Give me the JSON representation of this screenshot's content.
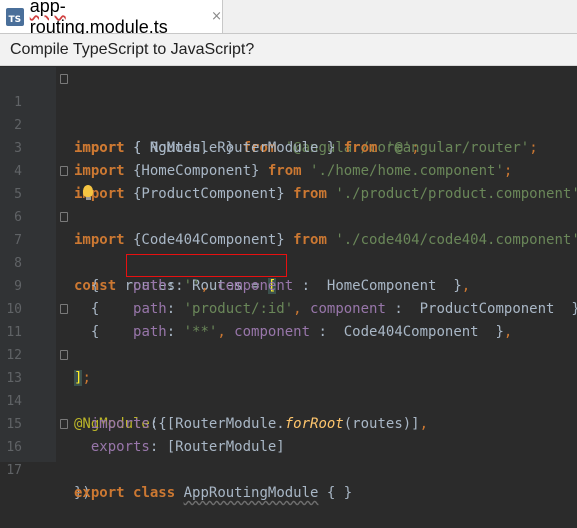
{
  "tab": {
    "icon_label": "TS",
    "title": "app-routing.module.ts",
    "close": "×"
  },
  "notice": {
    "text": "Compile TypeScript to JavaScript?"
  },
  "lines": [
    {
      "n": "1"
    },
    {
      "n": "2"
    },
    {
      "n": "3"
    },
    {
      "n": "4"
    },
    {
      "n": "5"
    },
    {
      "n": "6"
    },
    {
      "n": "7"
    },
    {
      "n": "8"
    },
    {
      "n": "9"
    },
    {
      "n": "10"
    },
    {
      "n": "11"
    },
    {
      "n": "12"
    },
    {
      "n": "13"
    },
    {
      "n": "14"
    },
    {
      "n": "15"
    },
    {
      "n": "16"
    },
    {
      "n": "17"
    }
  ],
  "code": {
    "l1": {
      "kw": "import",
      "mid": " { NgModule } ",
      "from": "from",
      "str": "'@angular/core'",
      "end": ";"
    },
    "l2": {
      "kw": "import",
      "mid": " { Routes, RouterModule } ",
      "from": "from",
      "str": "'@angular/router'",
      "end": ";"
    },
    "l3": {
      "kw": "import",
      "mid": " {HomeComponent} ",
      "from": "from",
      "str": "'./home/home.component'",
      "end": ";"
    },
    "l4": {
      "kw": "import",
      "mid": " {ProductComponent} ",
      "from": "from",
      "str": "'./product/product.component'",
      "end": ";"
    },
    "l5": {
      "kw": "import",
      "mid": " {Code404Component} ",
      "from": "from",
      "str": "'./code404/code404.component'",
      "end": ";"
    },
    "l7": {
      "kw": "const",
      "mid": " routes: Routes = ",
      "brk": "["
    },
    "l8": {
      "open": "{",
      "path": "path",
      "colon": ": ",
      "str": "''",
      "comma": ", ",
      "comp": "component",
      "sep": " :  ",
      "val": "HomeComponent",
      "close": "  }",
      "end": ","
    },
    "l9": {
      "open": "{",
      "path": "path",
      "colon": ": ",
      "str": "'product/:id'",
      "comma": ", ",
      "comp": "component",
      "sep": " :  ",
      "val": "ProductComponent",
      "close": "  }",
      "end": ","
    },
    "l10": {
      "open": "{",
      "path": "path",
      "colon": ": ",
      "str": "'**'",
      "comma": ", ",
      "comp": "component",
      "sep": " :  ",
      "val": "Code404Component",
      "close": "  }",
      "end": ","
    },
    "l11": {
      "brk": "]",
      "end": ";"
    },
    "l13": {
      "ann": "@NgModule",
      "rest": "({"
    },
    "l14": {
      "prop": "imports",
      "a": ": [RouterModule.",
      "fn": "forRoot",
      "b": "(routes)]",
      "end": ","
    },
    "l15": {
      "prop": "exports",
      "a": ": [RouterModule]"
    },
    "l16": {
      "text": "})"
    },
    "l17": {
      "kw1": "export",
      "kw2": "class",
      "cls": "AppRoutingModule",
      "rest": " { }"
    }
  },
  "colors": {
    "background": "#2b2b2b",
    "keyword": "#cc7832",
    "string": "#6a8759",
    "property": "#9876aa",
    "highlight_box": "#e81010"
  }
}
